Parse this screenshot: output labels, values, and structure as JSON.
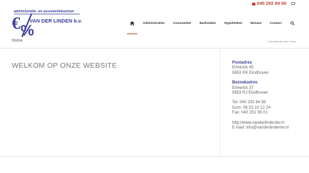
{
  "topbar": {
    "phone": "040 292 84 56",
    "phone_icon": "phone-icon",
    "mail_icon": "mail-icon"
  },
  "logo": {
    "tagline": "administratie- en assurantiekantoor",
    "name": "VAN DER LINDEN b.v.",
    "symbol": "€/%",
    "color": "#3b3f9a"
  },
  "nav": {
    "items": [
      "Administraties",
      "Assurantiën",
      "Bankzaken",
      "Hypotheken",
      "Nieuws",
      "Contact"
    ],
    "home_icon": "home-icon",
    "search_icon": "search-icon"
  },
  "breadcrumb": {
    "title": "Home",
    "prefix": "U bevindt zich hier:",
    "current": "Home"
  },
  "main": {
    "heading": "WELKOM OP ONZE WEBSITE"
  },
  "sidebar": {
    "postadres_label": "Postadres",
    "postadres_line1": "Eimerick 45",
    "postadres_line2": "5653 RK Eindhoven",
    "bezoekadres_label": "Bezoekadres",
    "bezoekadres_line1": "Eimerick 37",
    "bezoekadres_line2": "5653 RJ Eindhoven",
    "tel": "Tel: 040 292 84 56",
    "gsm": "Gsm: 06 53 10 12 24",
    "fax": "Fax: 040 251 59 01",
    "url": "http://www.vanderlindenbv.nl",
    "email": "E-mail: info@vanderlindenbv.nl"
  },
  "colors": {
    "accent": "#c0392b",
    "brand": "#3b3f9a"
  }
}
